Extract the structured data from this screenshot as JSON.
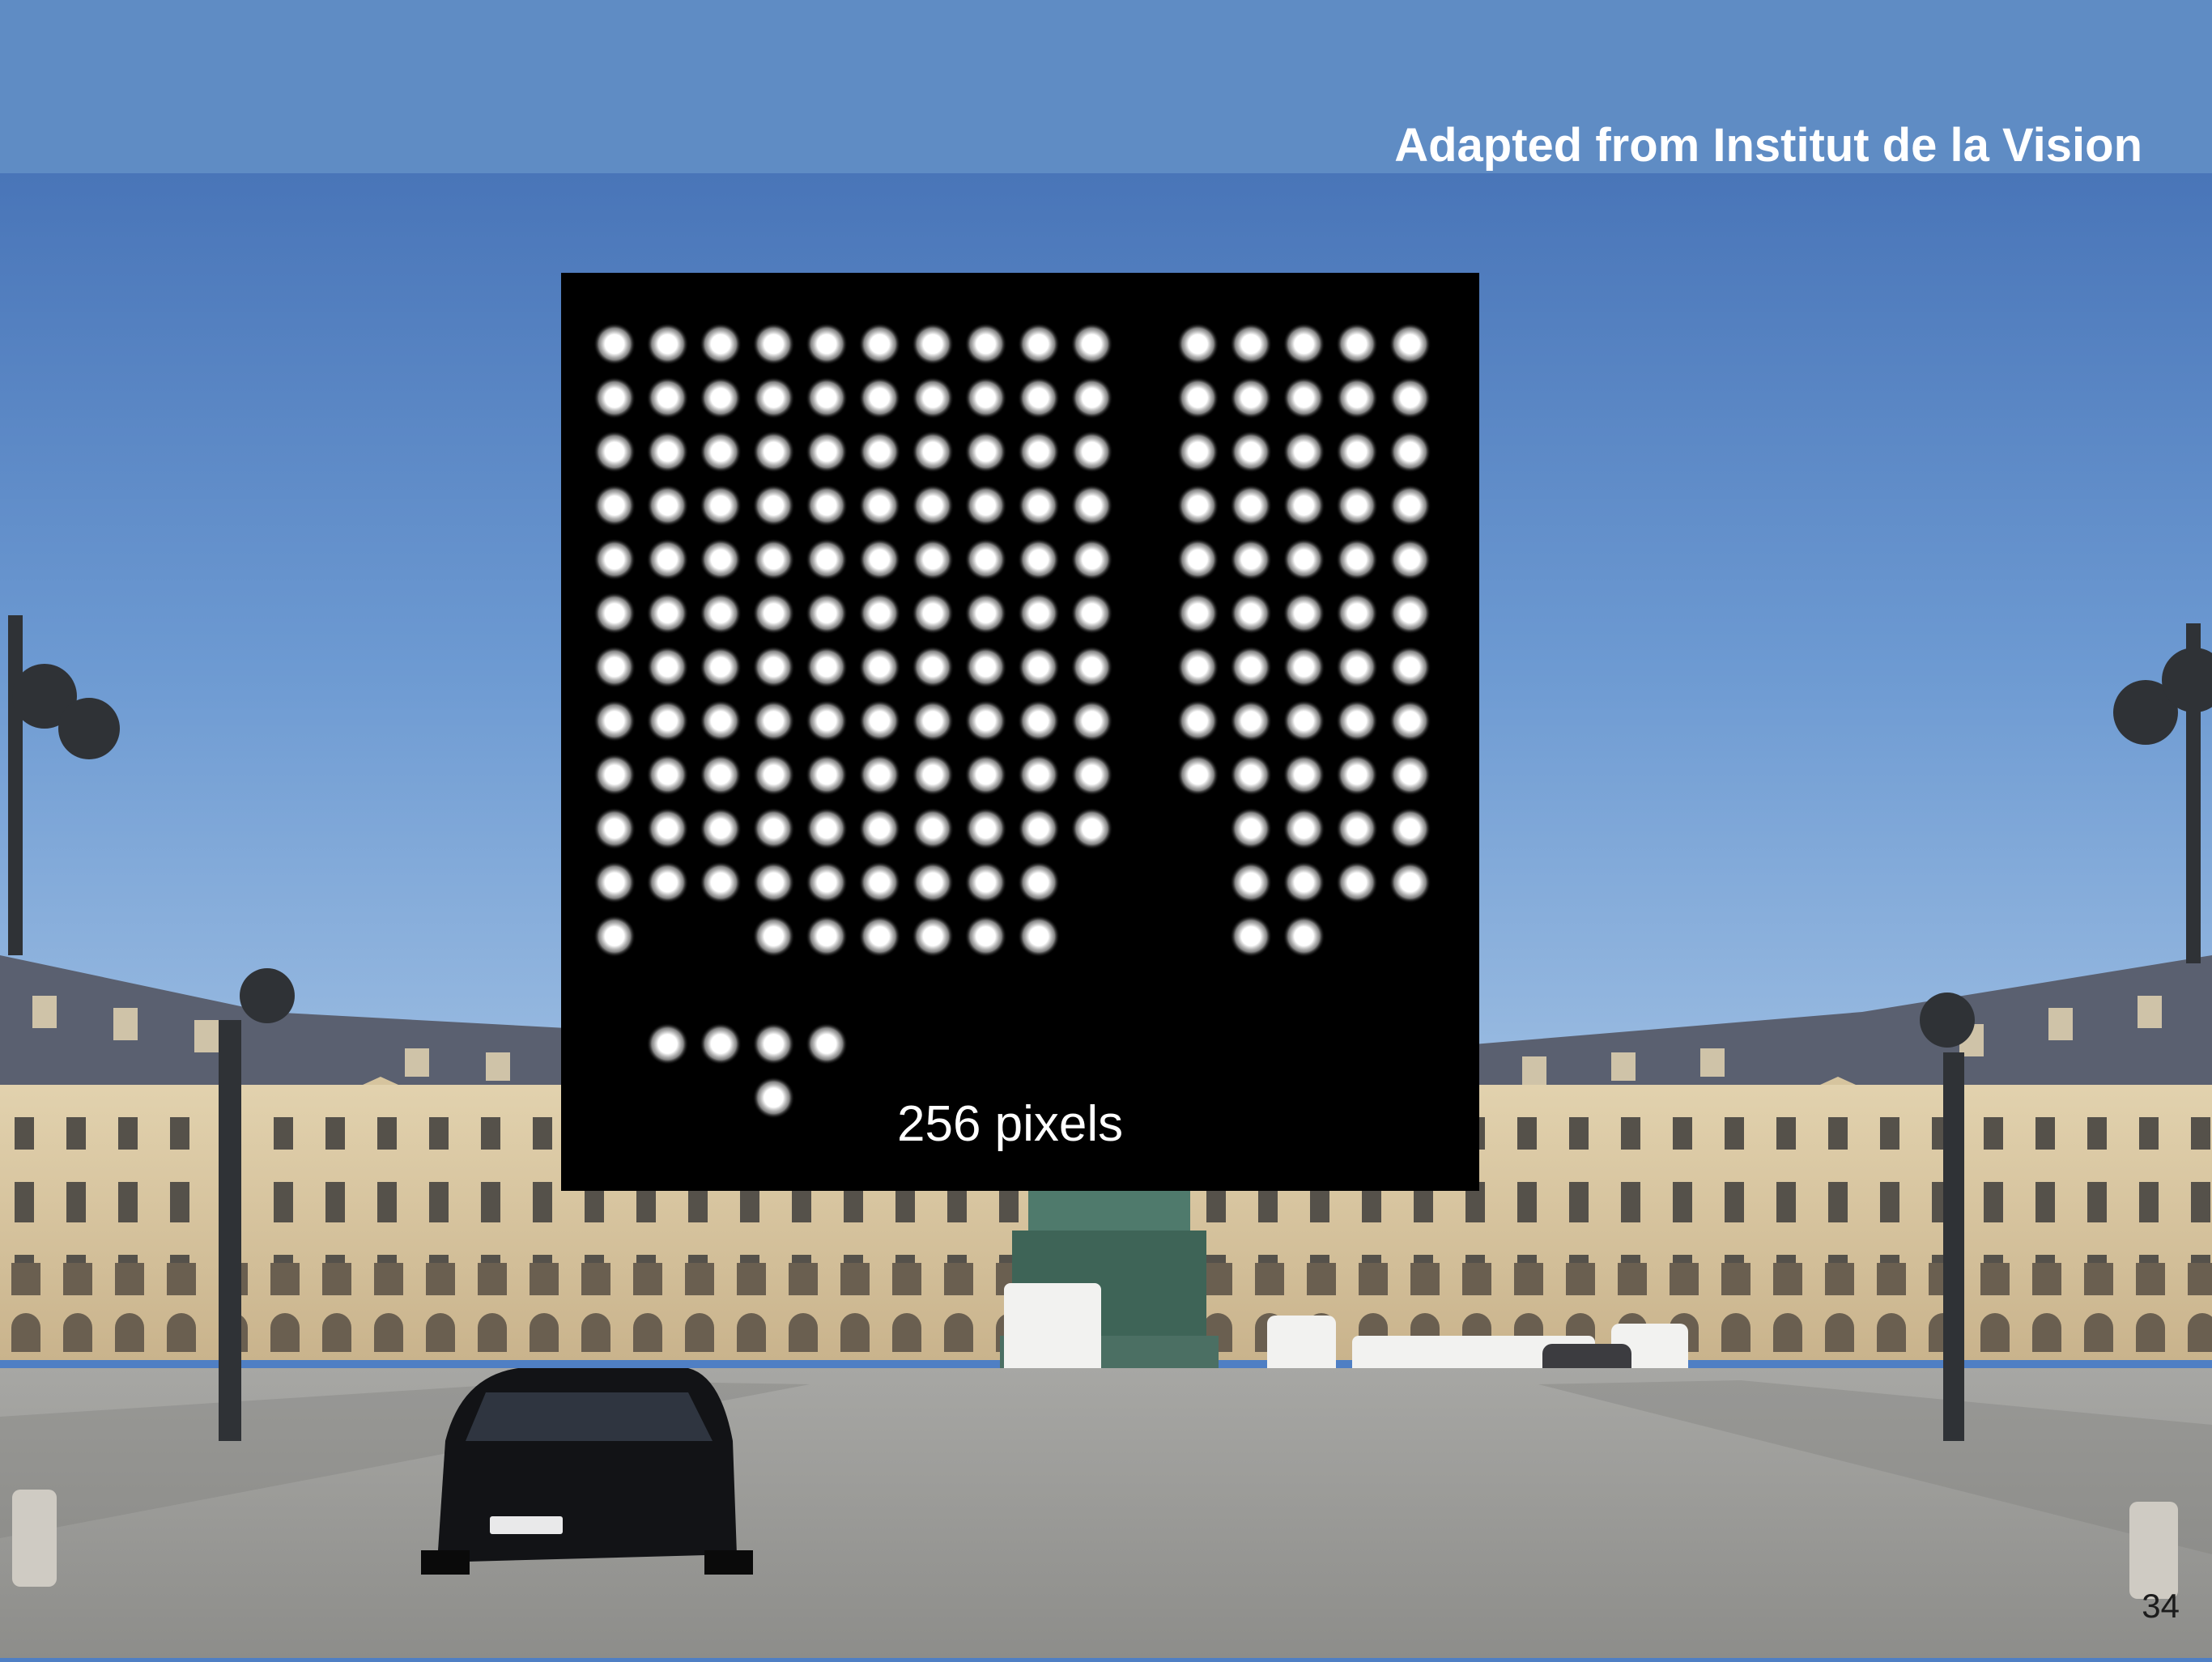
{
  "slide": {
    "credit": "Adapted from Institut de la Vision",
    "page_number": "34"
  },
  "panel": {
    "caption": "256 pixels",
    "dot_rows": [
      "1111111111 11111",
      "1111111111 11111",
      "1111111111 11111",
      "1111111111 11111",
      "1111111111 11111",
      "1111111111 11111",
      "1111111111 11111",
      "1111111111 11111",
      "1111111111 11111",
      "1111111111  1111",
      "111111111   1111",
      "1  111111   11",
      "",
      " 1111",
      "   1"
    ]
  },
  "photo": {
    "description_free": true
  },
  "colors": {
    "sky_top": "#3d69b0",
    "sky_bottom": "#8fb4dd",
    "band": "#5f8cc4",
    "panel": "#000000"
  }
}
